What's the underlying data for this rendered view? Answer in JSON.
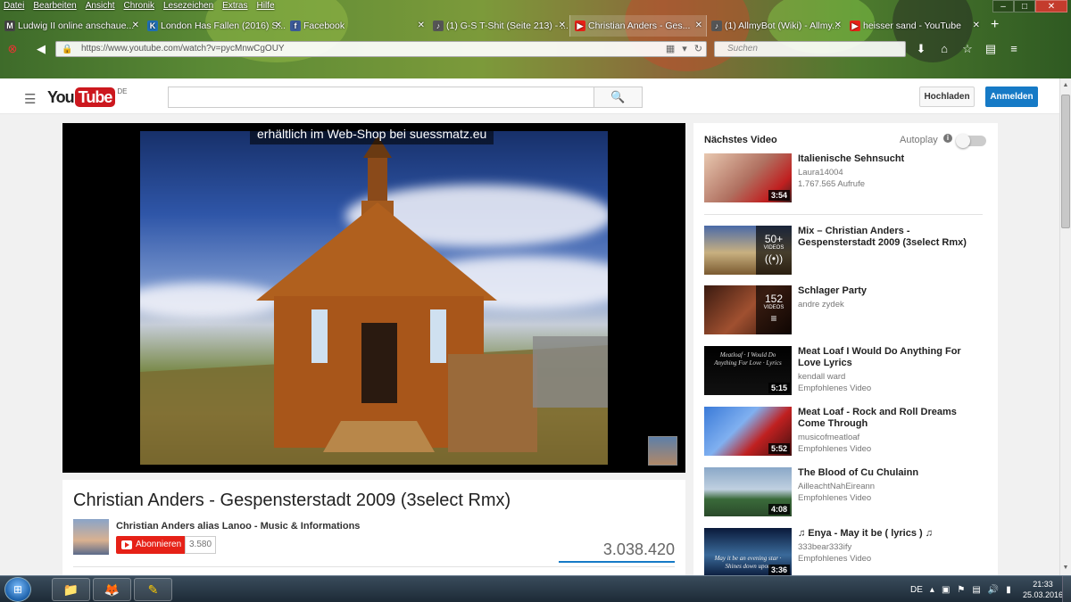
{
  "browser": {
    "menu": [
      "Datei",
      "Bearbeiten",
      "Ansicht",
      "Chronik",
      "Lesezeichen",
      "Extras",
      "Hilfe"
    ],
    "window_buttons": {
      "minimize": "–",
      "maximize": "□",
      "close": "✕"
    },
    "tabs": [
      {
        "label": "Ludwig II online anschaue...",
        "icon": "M",
        "color": "#444444"
      },
      {
        "label": "London Has Fallen (2016) S...",
        "icon": "K",
        "color": "#1f6fb5"
      },
      {
        "label": "Facebook",
        "icon": "f",
        "color": "#3b5998"
      },
      {
        "label": "(1) G-S T-Shit (Seite 213) - ...",
        "icon": "♪",
        "color": "#555555"
      },
      {
        "label": "Christian Anders - Ges...",
        "icon": "▶",
        "color": "#e62117"
      },
      {
        "label": "(1) AllmyBot (Wiki) - Allmy...",
        "icon": "♪",
        "color": "#555555"
      },
      {
        "label": "heisser sand - YouTube",
        "icon": "▶",
        "color": "#e62117"
      }
    ],
    "tab_close": "✕",
    "new_tab": "+",
    "url": "https://www.youtube.com/watch?v=pycMnwCgOUY",
    "search_placeholder": "Suchen"
  },
  "youtube": {
    "logo_you": "You",
    "logo_tube": "Tube",
    "logo_region": "DE",
    "upload_label": "Hochladen",
    "login_label": "Anmelden",
    "player": {
      "caption": "erhältlich im Web-Shop bei suessmatz.eu"
    },
    "video": {
      "title": "Christian Anders - Gespensterstadt 2009 (3select Rmx)",
      "channel": "Christian Anders alias Lanoo - Music & Informations",
      "subscribe_label": "Abonnieren",
      "subscriber_count": "3.580",
      "views": "3.038.420"
    },
    "sidebar": {
      "next_label": "Nächstes Video",
      "autoplay_label": "Autoplay",
      "autoplay_info": "i",
      "items": [
        {
          "title": "Italienische Sehnsucht",
          "channel": "Laura14004",
          "meta": "1.767.565 Aufrufe",
          "duration": "3:54",
          "thumb": "linear-gradient(135deg,#e8c8b0,#b07060 50%,#c02020 80%,#402020)"
        },
        {
          "title": "Mix – Christian Anders - Gespensterstadt 2009 (3select Rmx)",
          "playlist_count": "50+",
          "playlist_label": "VIDEOS",
          "playlist_glyph": "((•))",
          "thumb": "linear-gradient(180deg,#4a6aa8,#c8b080 55%,#7a5a30)"
        },
        {
          "title": "Schlager Party",
          "channel": "andre zydek",
          "playlist_count": "152",
          "playlist_label": "VIDEOS",
          "playlist_glyph": "≡",
          "thumb": "linear-gradient(135deg,#3a1a10,#a05030 50%,#2a1008)"
        },
        {
          "title": "Meat Loaf I Would Do Anything For Love Lyrics",
          "channel": "kendall ward",
          "meta": "Empfohlenes Video",
          "duration": "5:15",
          "thumb_text": "Meatloaf · I Would Do Anything For Love · Lyrics",
          "thumb": "linear-gradient(180deg,#000,#111)"
        },
        {
          "title": "Meat Loaf - Rock and Roll Dreams Come Through",
          "channel": "musicofmeatloaf",
          "meta": "Empfohlenes Video",
          "duration": "5:52",
          "thumb": "linear-gradient(135deg,#3a7ad8,#80b0f0 40%,#c02020 65%,#401010)"
        },
        {
          "title": "The Blood of Cu Chulainn",
          "channel": "AilleachtNahEireann",
          "meta": "Empfohlenes Video",
          "duration": "4:08",
          "thumb": "linear-gradient(180deg,#8aa8c8,#c0d0e0 45%,#3a6a3a 65%,#2a4a2a)"
        },
        {
          "title": "♫ Enya - May it be ( lyrics ) ♫",
          "channel": "333bear333ify",
          "meta": "Empfohlenes Video",
          "duration": "3:36",
          "thumb_text": "May it be an evening star · Shines down upon",
          "thumb": "linear-gradient(180deg,#0a1a3a,#3a6a9a 55%,#0a1a3a)"
        }
      ]
    }
  },
  "taskbar": {
    "start_glyph": "⊞",
    "apps": [
      {
        "name": "explorer",
        "glyph": "📁"
      },
      {
        "name": "firefox",
        "glyph": "🦊"
      },
      {
        "name": "app3",
        "glyph": "✎"
      }
    ],
    "language": "DE",
    "time": "21:33",
    "date": "25.03.2016"
  }
}
